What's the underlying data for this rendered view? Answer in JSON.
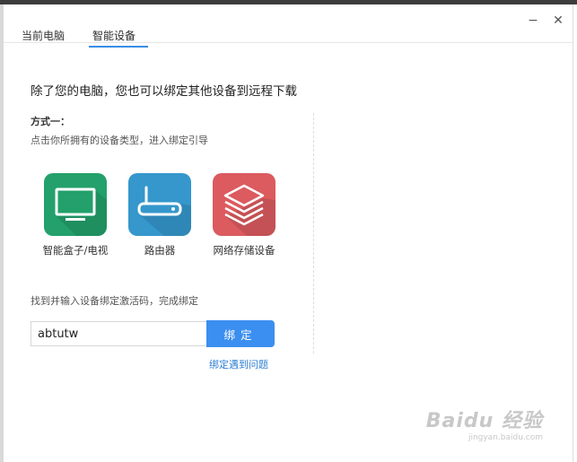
{
  "tabs": [
    {
      "label": "当前电脑",
      "active": false
    },
    {
      "label": "智能设备",
      "active": true
    }
  ],
  "window_controls": {
    "minimize": "−",
    "close": "✕"
  },
  "headline": "除了您的电脑，您也可以绑定其他设备到远程下载",
  "method": {
    "title": "方式一：",
    "description": "点击你所拥有的设备类型，进入绑定引导"
  },
  "devices": [
    {
      "label": "智能盒子/电视",
      "icon": "tv-icon",
      "color": "#23a06b"
    },
    {
      "label": "路由器",
      "icon": "router-icon",
      "color": "#3597cc"
    },
    {
      "label": "网络存储设备",
      "icon": "storage-stack-icon",
      "color": "#db5b5f"
    }
  ],
  "activation": {
    "instruction": "找到并输入设备绑定激活码，完成绑定",
    "code_value": "abtutw",
    "bind_button": "绑定",
    "help_link": "绑定遇到问题"
  },
  "watermark": {
    "main": "Baidu 经验",
    "sub": "jingyan.baidu.com"
  },
  "colors": {
    "accent": "#3b8ff0",
    "link": "#2f7fd4"
  }
}
